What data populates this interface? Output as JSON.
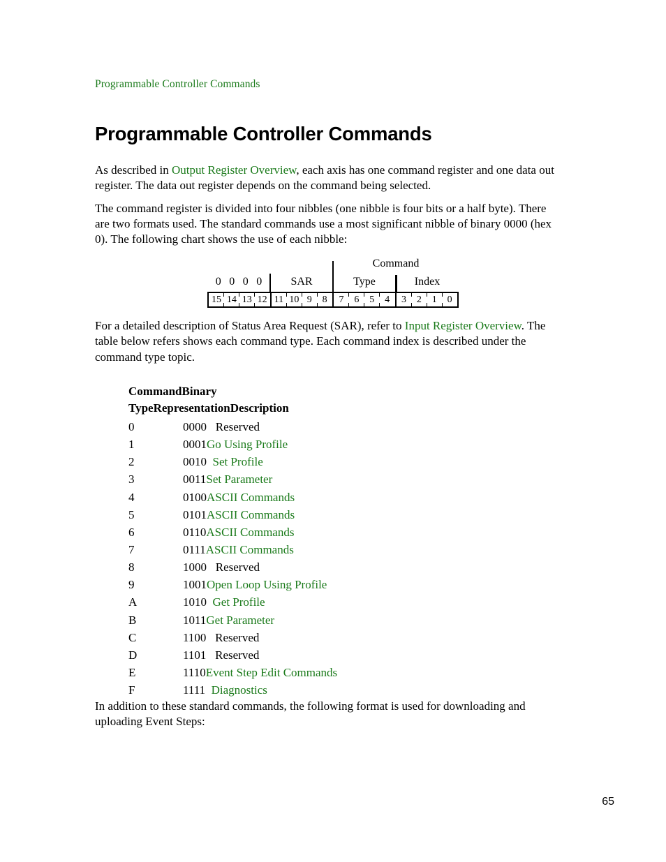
{
  "running_header": "Programmable Controller Commands",
  "title": "Programmable Controller Commands",
  "intro": {
    "p1_before": "As described in ",
    "p1_link": "Output Register Overview",
    "p1_after": ", each axis has one command register and one data out register.  The data out register depends on the command being selected.",
    "p2": "The command register is divided into four nibbles (one nibble is four bits or a half byte).  There are two formats used.  The standard commands use a most significant nibble of binary 0000 (hex 0).  The following chart shows the use of each nibble:"
  },
  "bitfield": {
    "command_label": "Command",
    "groups": [
      {
        "label": "0 0 0 0",
        "zeros": [
          "0",
          "0",
          "0",
          "0"
        ]
      },
      {
        "label": "SAR"
      },
      {
        "label": "Type"
      },
      {
        "label": "Index"
      }
    ],
    "bits": [
      "15",
      "14",
      "13",
      "12",
      "11",
      "10",
      "9",
      "8",
      "7",
      "6",
      "5",
      "4",
      "3",
      "2",
      "1",
      "0"
    ]
  },
  "sar_para": {
    "before": "For a detailed description of Status Area Request (SAR), refer to ",
    "link": "Input Register Overview",
    "after": ".  The table below refers shows each command type.  Each command index is described under the command type topic."
  },
  "table": {
    "header_line1": "CommandBinary",
    "header_line2": "TypeRepresentationDescription",
    "rows": [
      {
        "type": "0",
        "binary": "0000",
        "gap": "   ",
        "description": "Reserved",
        "is_link": false
      },
      {
        "type": "1",
        "binary": "0001",
        "gap": "",
        "description": "Go Using Profile",
        "is_link": true
      },
      {
        "type": "2",
        "binary": "0010",
        "gap": "  ",
        "description": "Set Profile",
        "is_link": true
      },
      {
        "type": "3",
        "binary": "0011",
        "gap": "",
        "description": "Set Parameter",
        "is_link": true
      },
      {
        "type": "4",
        "binary": "0100",
        "gap": "",
        "description": "ASCII Commands",
        "is_link": true
      },
      {
        "type": "5",
        "binary": "0101",
        "gap": "",
        "description": "ASCII Commands",
        "is_link": true
      },
      {
        "type": "6",
        "binary": "0110",
        "gap": "",
        "description": "ASCII Commands",
        "is_link": true
      },
      {
        "type": "7",
        "binary": "0111",
        "gap": "",
        "description": "ASCII Commands",
        "is_link": true
      },
      {
        "type": "8",
        "binary": "1000",
        "gap": "   ",
        "description": "Reserved",
        "is_link": false
      },
      {
        "type": "9",
        "binary": "1001",
        "gap": "",
        "description": "Open Loop Using Profile",
        "is_link": true
      },
      {
        "type": "A",
        "binary": "1010",
        "gap": "  ",
        "description": "Get Profile",
        "is_link": true
      },
      {
        "type": "B",
        "binary": "1011",
        "gap": "",
        "description": "Get Parameter",
        "is_link": true
      },
      {
        "type": "C",
        "binary": "1100",
        "gap": "   ",
        "description": "Reserved",
        "is_link": false
      },
      {
        "type": "D",
        "binary": "1101",
        "gap": "   ",
        "description": "Reserved",
        "is_link": false
      },
      {
        "type": "E",
        "binary": "1110",
        "gap": "",
        "description": "Event Step Edit Commands",
        "is_link": true
      },
      {
        "type": "F",
        "binary": "1111",
        "gap": "  ",
        "description": "Diagnostics",
        "is_link": true
      }
    ]
  },
  "closing_para": "In addition to these standard commands, the following format is used for downloading and uploading Event Steps:",
  "page_number": "65",
  "colors": {
    "link_green": "#1a7a1a",
    "text_black": "#000000",
    "background": "#ffffff"
  }
}
